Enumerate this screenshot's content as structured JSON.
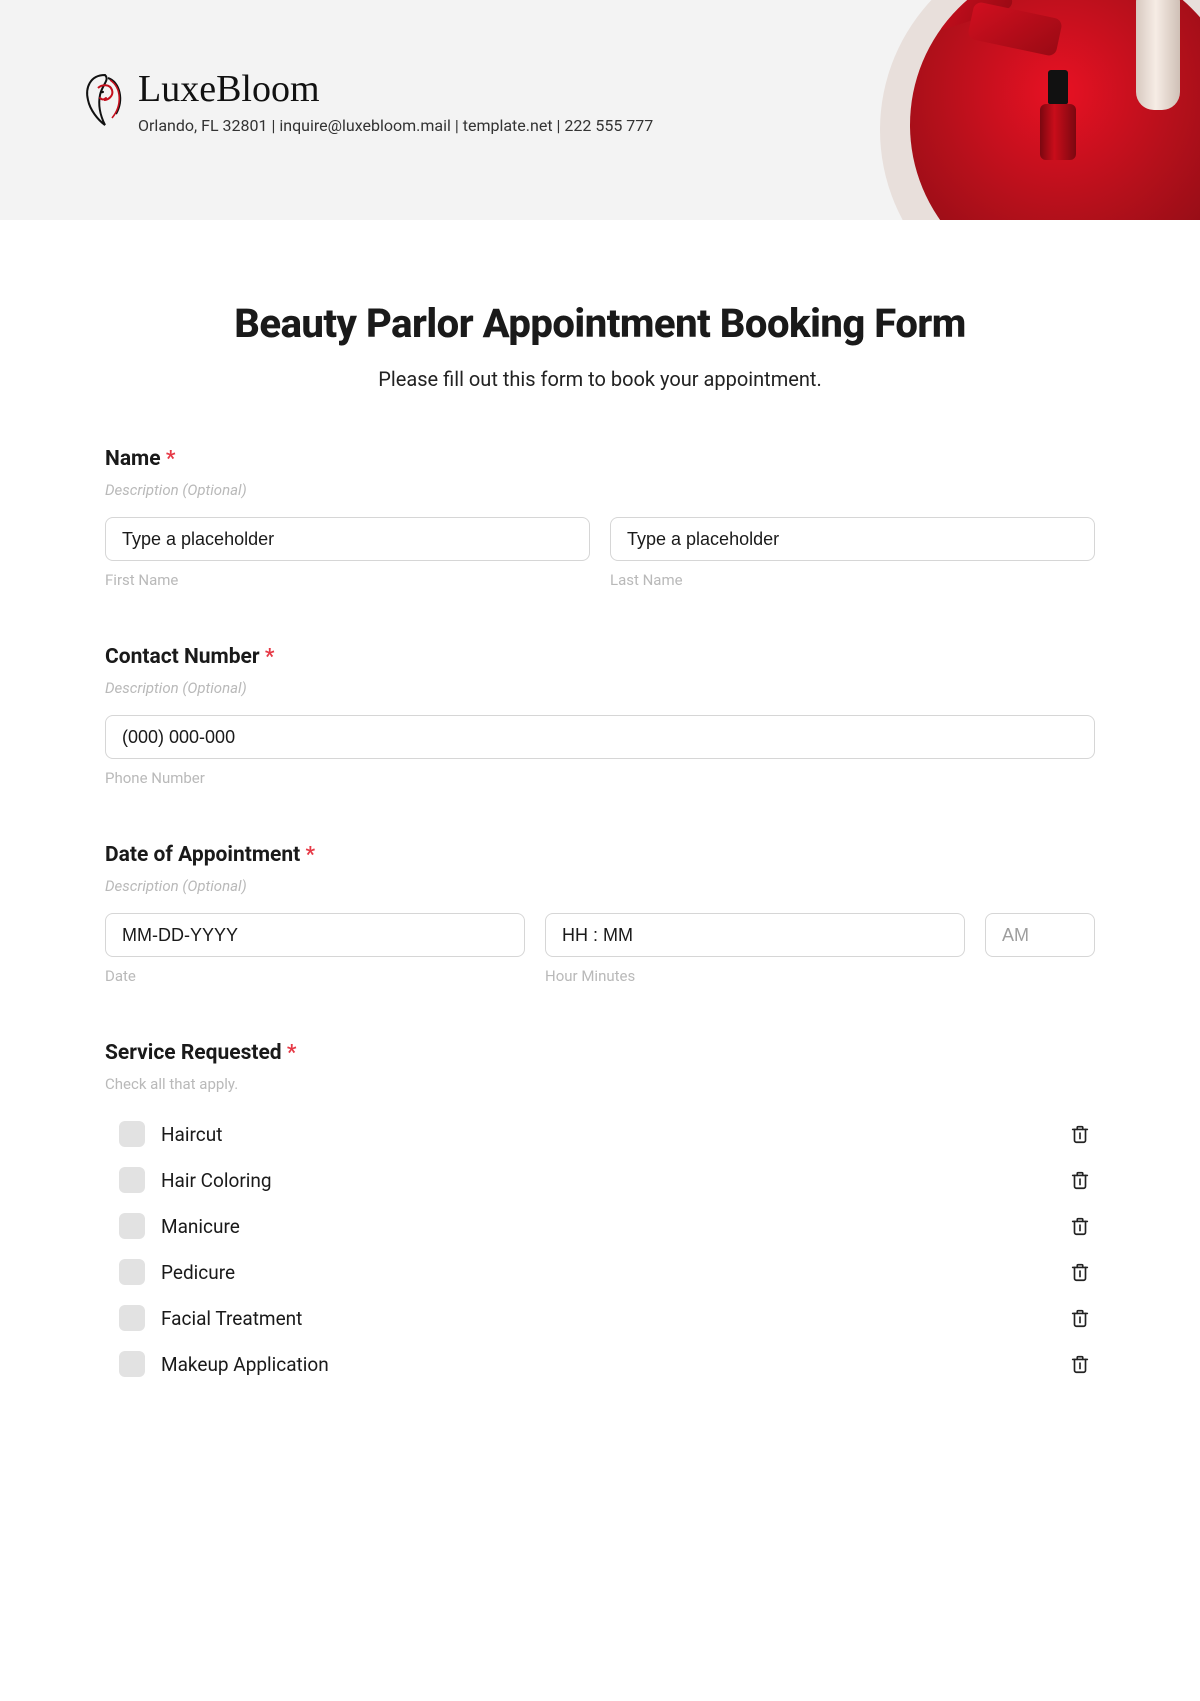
{
  "brand": {
    "name": "LuxeBloom",
    "info": "Orlando, FL 32801 | inquire@luxebloom.mail | template.net | 222 555 777"
  },
  "title": "Beauty Parlor Appointment Booking Form",
  "subtitle": "Please fill out this form to book your appointment.",
  "name": {
    "label": "Name",
    "desc": "Description (Optional)",
    "first_placeholder": "Type a placeholder",
    "last_placeholder": "Type a placeholder",
    "first_sub": "First Name",
    "last_sub": "Last Name"
  },
  "contact": {
    "label": "Contact Number",
    "desc": "Description (Optional)",
    "placeholder": "(000) 000-000",
    "sub": "Phone Number"
  },
  "appt": {
    "label": "Date of Appointment",
    "desc": "Description (Optional)",
    "date_placeholder": "MM-DD-YYYY",
    "time_placeholder": "HH : MM",
    "ampm": "AM",
    "date_sub": "Date",
    "time_sub": "Hour Minutes"
  },
  "service": {
    "label": "Service Requested",
    "help": "Check all that apply.",
    "items": [
      "Haircut",
      "Hair Coloring",
      "Manicure",
      "Pedicure",
      "Facial Treatment",
      "Makeup Application"
    ]
  },
  "required_marker": "*"
}
